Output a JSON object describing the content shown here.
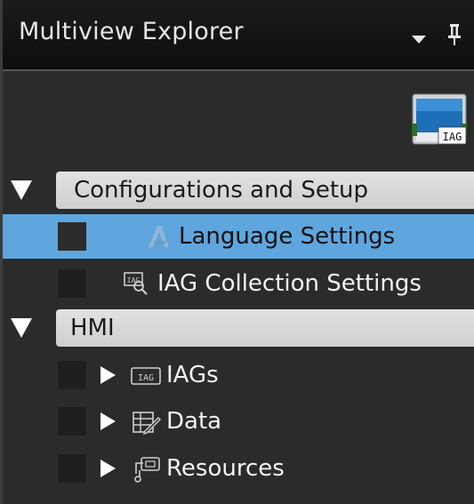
{
  "panel": {
    "title": "Multiview Explorer",
    "device_badge_text": "IAG"
  },
  "groups": [
    {
      "label": "Configurations and Setup",
      "items": [
        {
          "label": "Language Settings",
          "icon": "language-icon",
          "selected": true
        },
        {
          "label": "IAG Collection Settings",
          "icon": "collection-icon",
          "selected": false
        }
      ]
    },
    {
      "label": "HMI",
      "items": [
        {
          "label": "IAGs",
          "icon": "iag-icon",
          "expandable": true
        },
        {
          "label": "Data",
          "icon": "data-icon",
          "expandable": true
        },
        {
          "label": "Resources",
          "icon": "resources-icon",
          "expandable": true
        }
      ]
    }
  ],
  "colors": {
    "selection": "#5ea6dd",
    "panel_bg": "#2b2b2b",
    "group_header_bg": "#d8d8d8"
  }
}
